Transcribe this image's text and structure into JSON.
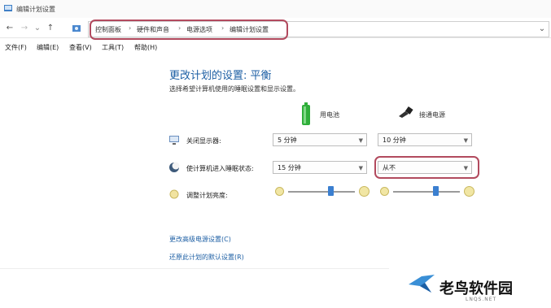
{
  "window": {
    "title": "编辑计划设置"
  },
  "nav": {
    "back": "←",
    "forward": "→",
    "dropdown": "⌄",
    "up": "↑",
    "breadcrumbs": [
      "控制面板",
      "硬件和声音",
      "电源选项",
      "编辑计划设置"
    ],
    "separator": "›",
    "address_dropdown": "⌄"
  },
  "menu": [
    "文件(F)",
    "编辑(E)",
    "查看(V)",
    "工具(T)",
    "帮助(H)"
  ],
  "main": {
    "heading": "更改计划的设置: 平衡",
    "description": "选择希望计算机使用的睡眠设置和显示设置。",
    "columns": {
      "battery": "用电池",
      "plugged": "接通电源"
    },
    "rows": [
      {
        "label": "关闭显示器:",
        "battery": "5 分钟",
        "plugged": "10 分钟"
      },
      {
        "label": "使计算机进入睡眠状态:",
        "battery": "15 分钟",
        "plugged": "从不"
      },
      {
        "label": "调整计划亮度:"
      }
    ],
    "brightness": {
      "battery": 0.65,
      "plugged": 0.65
    },
    "links": [
      "更改高级电源设置(C)",
      "还原此计划的默认设置(R)"
    ]
  },
  "watermark": {
    "brand": "老鸟软件园",
    "site": "LNQS.NET"
  },
  "icons": {
    "app": "control-panel-icon",
    "battery": "battery-icon",
    "plug": "plug-icon"
  },
  "colors": {
    "accent": "#1d5fa4",
    "highlight": "#b24a5e",
    "battery_green": "#2fae3a"
  }
}
